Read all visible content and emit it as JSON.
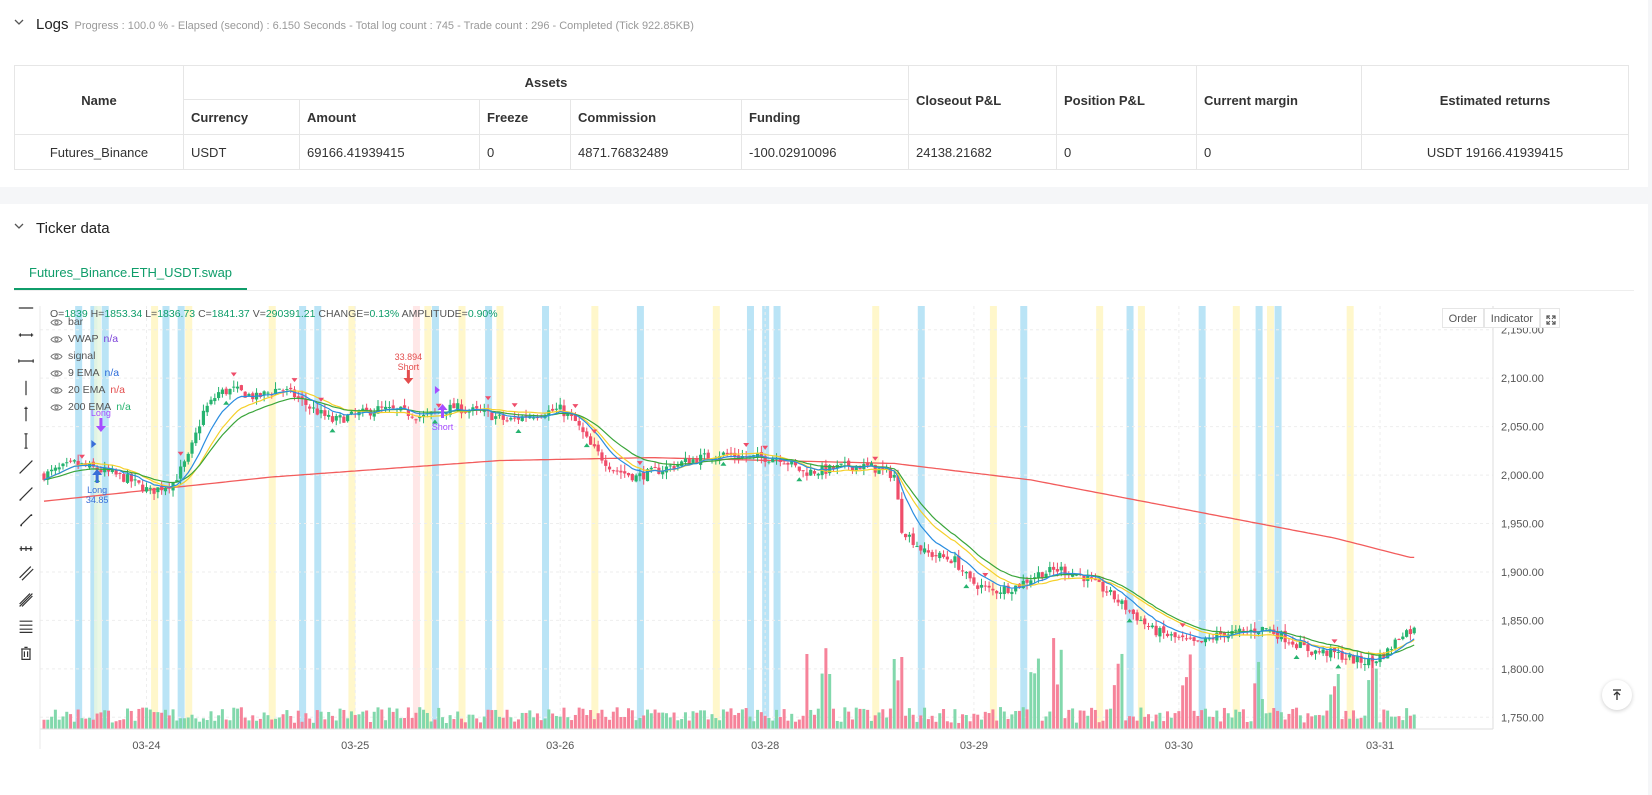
{
  "logs": {
    "title": "Logs",
    "summary": "Progress : 100.0 % - Elapsed (second) : 6.150  Seconds - Total log count : 745 - Trade count : 296 - Completed (Tick 922.85KB)"
  },
  "assets_table": {
    "group_header": "Assets",
    "headers": {
      "name": "Name",
      "currency": "Currency",
      "amount": "Amount",
      "freeze": "Freeze",
      "commission": "Commission",
      "funding": "Funding",
      "closeout_pl": "Closeout P&L",
      "position_pl": "Position P&L",
      "current_margin": "Current margin",
      "estimated_returns": "Estimated returns"
    },
    "row": {
      "name": "Futures_Binance",
      "currency": "USDT",
      "amount": "69166.41939415",
      "freeze": "0",
      "commission": "4871.76832489",
      "funding": "-100.02910096",
      "closeout_pl": "24138.21682",
      "position_pl": "0",
      "current_margin": "0",
      "estimated_returns": "USDT 19166.41939415"
    }
  },
  "ticker": {
    "title": "Ticker data",
    "tab_label": "Futures_Binance.ETH_USDT.swap",
    "buttons": {
      "order": "Order",
      "indicator": "Indicator"
    },
    "ohlc": {
      "o_label": "O=",
      "o": "1839",
      "h_label": "H=",
      "h": "1853.34",
      "l_label": "L=",
      "l": "1836.73",
      "c_label": "C=",
      "c": "1841.37",
      "v_label": "V=",
      "v": "290391.21",
      "change_label": "CHANGE=",
      "change": "0.13%",
      "amp_label": "AMPLITUDE=",
      "amp": "0.90%"
    },
    "legend": [
      {
        "name": "bar",
        "value": ""
      },
      {
        "name": "VWAP",
        "value": "n/a"
      },
      {
        "name": "signal",
        "value": ""
      },
      {
        "name": "9 EMA",
        "value": "n/a"
      },
      {
        "name": "20 EMA",
        "value": "n/a"
      },
      {
        "name": "200 EMA",
        "value": "n/a"
      }
    ],
    "tools": [
      "horizontal-line-icon",
      "horizontal-ray-icon",
      "extended-line-icon",
      "vertical-line-icon",
      "vertical-ray-icon",
      "vertical-segment-icon",
      "trend-line-icon",
      "trend-ray-icon",
      "trend-segment-icon",
      "measure-icon",
      "parallel-channel-icon",
      "pitchfork-icon",
      "fibonacci-icon",
      "trash-icon"
    ]
  },
  "chart_data": {
    "type": "candlestick",
    "x_ticks": [
      "03-24",
      "03-25",
      "03-26",
      "03-28",
      "03-29",
      "03-30",
      "03-31"
    ],
    "y_ticks": [
      "2,150.00",
      "2,100.00",
      "2,050.00",
      "2,000.00",
      "1,950.00",
      "1,900.00",
      "1,850.00",
      "1,800.00",
      "1,750.00"
    ],
    "ylim": [
      1740,
      2170
    ],
    "annotations": [
      {
        "text": "Long",
        "value": "34.85",
        "color": "#3a6fd8"
      },
      {
        "text": "Long",
        "value": "",
        "color": "#a64dff"
      },
      {
        "text": "Short",
        "value": "33.894",
        "color": "#e34d4d"
      },
      {
        "text": "Short",
        "value": "",
        "color": "#a64dff"
      }
    ],
    "price_anchors": [
      [
        0,
        2000
      ],
      [
        8,
        2012
      ],
      [
        14,
        2006
      ],
      [
        22,
        1996
      ],
      [
        28,
        1983
      ],
      [
        34,
        1992
      ],
      [
        38,
        2018
      ],
      [
        42,
        2065
      ],
      [
        46,
        2085
      ],
      [
        50,
        2088
      ],
      [
        56,
        2080
      ],
      [
        62,
        2090
      ],
      [
        66,
        2082
      ],
      [
        70,
        2070
      ],
      [
        76,
        2056
      ],
      [
        82,
        2062
      ],
      [
        88,
        2068
      ],
      [
        94,
        2066
      ],
      [
        100,
        2060
      ],
      [
        108,
        2070
      ],
      [
        116,
        2064
      ],
      [
        122,
        2056
      ],
      [
        128,
        2062
      ],
      [
        136,
        2068
      ],
      [
        140,
        2055
      ],
      [
        144,
        2030
      ],
      [
        150,
        2006
      ],
      [
        156,
        1998
      ],
      [
        162,
        2005
      ],
      [
        170,
        2015
      ],
      [
        178,
        2022
      ],
      [
        186,
        2018
      ],
      [
        194,
        2018
      ],
      [
        200,
        2003
      ],
      [
        206,
        2005
      ],
      [
        212,
        2010
      ],
      [
        218,
        2008
      ],
      [
        224,
        2000
      ],
      [
        226,
        1945
      ],
      [
        232,
        1920
      ],
      [
        240,
        1912
      ],
      [
        244,
        1890
      ],
      [
        250,
        1880
      ],
      [
        256,
        1885
      ],
      [
        262,
        1898
      ],
      [
        268,
        1903
      ],
      [
        274,
        1895
      ],
      [
        280,
        1880
      ],
      [
        286,
        1860
      ],
      [
        292,
        1840
      ],
      [
        298,
        1832
      ],
      [
        304,
        1825
      ],
      [
        310,
        1836
      ],
      [
        316,
        1838
      ],
      [
        322,
        1842
      ],
      [
        328,
        1830
      ],
      [
        334,
        1818
      ],
      [
        340,
        1816
      ],
      [
        346,
        1808
      ],
      [
        350,
        1808
      ],
      [
        354,
        1818
      ],
      [
        358,
        1838
      ],
      [
        361,
        1840
      ]
    ],
    "ema200_anchors": [
      [
        0,
        1973
      ],
      [
        60,
        1998
      ],
      [
        120,
        2015
      ],
      [
        160,
        2018
      ],
      [
        224,
        2012
      ],
      [
        260,
        1995
      ],
      [
        300,
        1965
      ],
      [
        340,
        1935
      ],
      [
        360,
        1915
      ]
    ],
    "volume_spikes": [
      [
        206,
        1820
      ],
      [
        225,
        1833
      ],
      [
        261,
        1816
      ],
      [
        267,
        1824
      ],
      [
        283,
        1815
      ],
      [
        301,
        1814
      ],
      [
        320,
        1823
      ],
      [
        340,
        1818
      ],
      [
        350,
        1807
      ]
    ]
  }
}
